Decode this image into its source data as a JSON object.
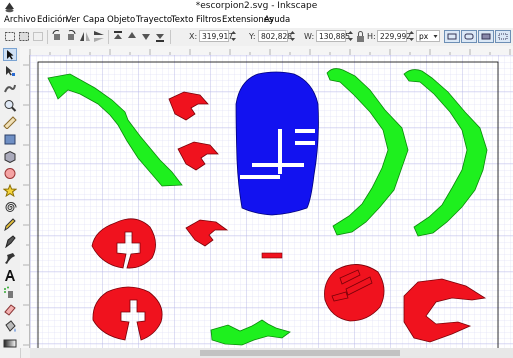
{
  "window": {
    "title": "*escorpion2.svg - Inkscape"
  },
  "menu": [
    "Archivo",
    "Edición",
    "Ver",
    "Capa",
    "Objeto",
    "Trayecto",
    "Texto",
    "Filtros",
    "Extensiones",
    "Ayuda"
  ],
  "toolbar": {
    "x_label": "X:",
    "x_value": "319,917",
    "y_label": "Y:",
    "y_value": "802,828",
    "w_label": "W:",
    "w_value": "130,885",
    "h_label": "H:",
    "h_value": "229,992",
    "unit": "px"
  },
  "tools": [
    "selector-tool",
    "node-tool",
    "tweak-tool",
    "zoom-tool",
    "measure-tool",
    "rectangle-tool",
    "3d-box-tool",
    "ellipse-tool",
    "star-tool",
    "spiral-tool",
    "pencil-tool",
    "pen-tool",
    "calligraphy-tool",
    "text-tool",
    "spray-tool",
    "eraser-tool",
    "bucket-tool",
    "gradient-tool"
  ],
  "colors": {
    "red": "#f0121e",
    "green": "#1ef01e",
    "blue": "#1212f0",
    "grid": "#c8c8ef",
    "page_border": "#000000"
  }
}
